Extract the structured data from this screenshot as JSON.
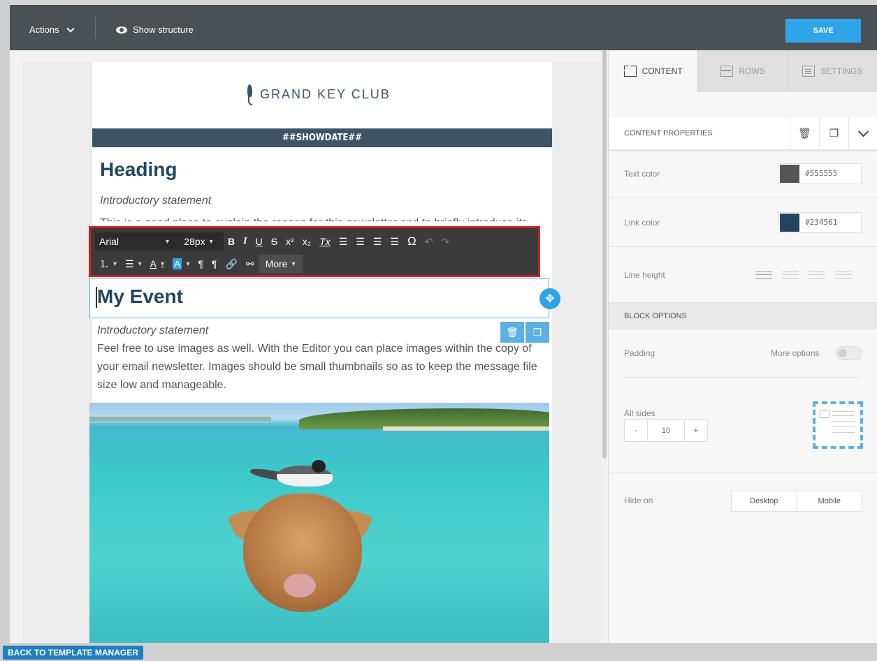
{
  "topbar": {
    "actions_label": "Actions",
    "show_structure_label": "Show structure",
    "save_label": "SAVE"
  },
  "email": {
    "logo_text": "GRAND KEY CLUB",
    "showdate": "##SHOWDATE##",
    "heading": "Heading",
    "intro1": "Introductory statement",
    "hidden_text": "This is a good place to explain the reason for this newsletter and to briefly introduce its",
    "event_title": "My Event",
    "intro2": "Introductory statement",
    "body": "Feel free to use images as well. With the Editor you can place images within the copy of your email newsletter. Images should be small thumbnails so as to keep the message file size low and manageable."
  },
  "toolbar": {
    "font": "Arial",
    "size": "28px",
    "bold": "B",
    "italic": "I",
    "underline": "U",
    "strike": "S",
    "superscript": "x²",
    "subscript": "x₂",
    "clear_format": "Tx",
    "special_char": "Ω",
    "more_label": "More"
  },
  "bottom": {
    "back_label": "BACK TO TEMPLATE MANAGER"
  },
  "panel": {
    "tabs": [
      {
        "label": "CONTENT",
        "icon": "grid-icon",
        "active": true
      },
      {
        "label": "ROWS",
        "icon": "rows-icon",
        "active": false
      },
      {
        "label": "SETTINGS",
        "icon": "settings-icon",
        "active": false
      }
    ],
    "content_properties_title": "CONTENT PROPERTIES",
    "text_color_label": "Text color",
    "text_color_value": "#555555",
    "link_color_label": "Link color",
    "link_color_value": "#234561",
    "line_height_label": "Line height",
    "block_options_title": "BLOCK OPTIONS",
    "padding_label": "Padding",
    "more_options_label": "More options",
    "all_sides_label": "All sides",
    "padding_minus": "-",
    "padding_value": "10",
    "padding_plus": "+",
    "hide_on_label": "Hide on",
    "hide_desktop": "Desktop",
    "hide_mobile": "Mobile"
  },
  "colors": {
    "accent": "#2fa4e7",
    "topbar": "#4b5054",
    "brand_heading": "#234561",
    "highlight_border": "#d01f1f"
  }
}
